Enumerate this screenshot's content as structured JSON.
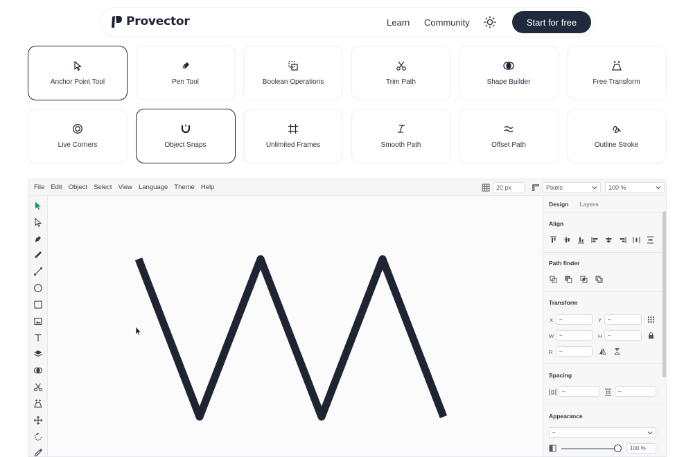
{
  "brand": {
    "name": "Provector"
  },
  "nav": {
    "learn": "Learn",
    "community": "Community",
    "cta": "Start for free"
  },
  "features": [
    {
      "label": "Anchor Point Tool",
      "icon": "cursor-outline-icon",
      "active": true
    },
    {
      "label": "Pen Tool",
      "icon": "pen-nib-icon",
      "active": false
    },
    {
      "label": "Boolean Operations",
      "icon": "boolean-squares-icon",
      "active": false
    },
    {
      "label": "Trim Path",
      "icon": "scissors-icon",
      "active": false
    },
    {
      "label": "Shape Builder",
      "icon": "overlap-circles-icon",
      "active": false
    },
    {
      "label": "Free Transform",
      "icon": "free-transform-icon",
      "active": false
    },
    {
      "label": "Live Corners",
      "icon": "target-circle-icon",
      "active": false
    },
    {
      "label": "Object Snaps",
      "icon": "magnet-icon",
      "active": true
    },
    {
      "label": "Unlimited Frames",
      "icon": "frame-icon",
      "active": false
    },
    {
      "label": "Smooth Path",
      "icon": "smooth-path-icon",
      "active": false
    },
    {
      "label": "Offset Path",
      "icon": "approx-icon",
      "active": false
    },
    {
      "label": "Outline Stroke",
      "icon": "outline-stroke-icon",
      "active": false
    }
  ],
  "editor": {
    "menu": [
      "File",
      "Edit",
      "Object",
      "Select",
      "View",
      "Language",
      "Theme",
      "Help"
    ],
    "grid_size": "20 px",
    "unit": "Pixels",
    "zoom": "100 %",
    "tools": [
      "select-arrow",
      "direct-select",
      "pen",
      "pencil",
      "line",
      "ellipse",
      "rectangle",
      "image",
      "text",
      "layers",
      "shape-builder",
      "scissors",
      "free-transform",
      "move",
      "rotate",
      "eyedropper"
    ],
    "canvas": {
      "stroke_color": "#1f2433",
      "path_points": [
        [
          0,
          0
        ],
        [
          88,
          228
        ],
        [
          176,
          0
        ],
        [
          264,
          228
        ],
        [
          352,
          0
        ],
        [
          440,
          228
        ]
      ]
    }
  },
  "panel": {
    "tabs": {
      "design": "Design",
      "layers": "Layers"
    },
    "align": {
      "title": "Align"
    },
    "pathfinder": {
      "title": "Path finder"
    },
    "transform": {
      "title": "Transform",
      "x_label": "X",
      "y_label": "Y",
      "w_label": "W",
      "h_label": "H",
      "r_label": "R",
      "x": "–",
      "y": "–",
      "w": "–",
      "h": "–",
      "r": "–"
    },
    "spacing": {
      "title": "Spacing",
      "h": "–",
      "v": "–"
    },
    "appearance": {
      "title": "Appearance",
      "blend": "–",
      "opacity": "100 %"
    }
  },
  "colors": {
    "accent": "#1f2a3c",
    "active_tool": "#1a8f7e"
  }
}
